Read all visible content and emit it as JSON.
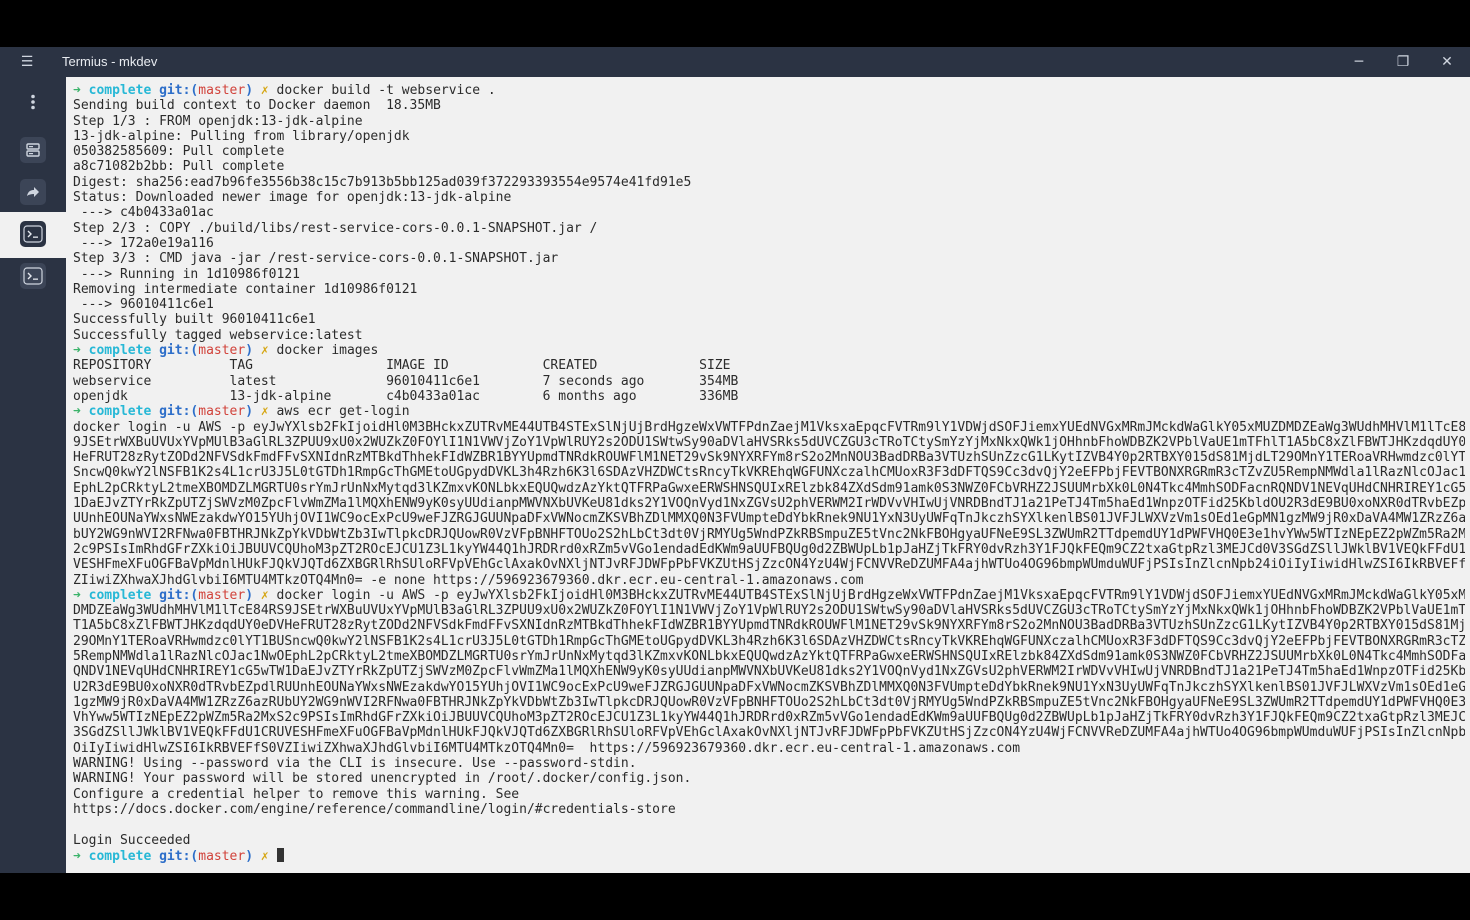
{
  "window": {
    "title": "Termius - mkdev"
  },
  "titlebar": {
    "menu_icon": "hamburger-icon",
    "minimize": "─",
    "maximize": "❐",
    "close": "✕"
  },
  "sidebar": {
    "items": [
      {
        "name": "more-options",
        "icon": "vertical-dots-icon"
      },
      {
        "name": "hosts",
        "icon": "server-icon"
      },
      {
        "name": "port-forwarding",
        "icon": "forward-icon"
      },
      {
        "name": "terminal-1",
        "icon": "terminal-icon",
        "active": true
      },
      {
        "name": "terminal-2",
        "icon": "terminal-icon"
      }
    ]
  },
  "prompt": {
    "arrow": "➜",
    "dir": "complete",
    "git": "git:",
    "paren_open": "(",
    "branch": "master",
    "paren_close": ")",
    "x": "✗"
  },
  "lines": [
    {
      "p": 1,
      "t": "docker build -t webservice ."
    },
    {
      "t": "Sending build context to Docker daemon  18.35MB"
    },
    {
      "t": "Step 1/3 : FROM openjdk:13-jdk-alpine"
    },
    {
      "t": "13-jdk-alpine: Pulling from library/openjdk"
    },
    {
      "t": "050382585609: Pull complete"
    },
    {
      "t": "a8c71082b2bb: Pull complete"
    },
    {
      "t": "Digest: sha256:ead7b96fe3556b38c15c7b913b5bb125ad039f372293393554e9574e41fd91e5"
    },
    {
      "t": "Status: Downloaded newer image for openjdk:13-jdk-alpine"
    },
    {
      "t": " ---> c4b0433a01ac"
    },
    {
      "t": "Step 2/3 : COPY ./build/libs/rest-service-cors-0.0.1-SNAPSHOT.jar /"
    },
    {
      "t": " ---> 172a0e19a116"
    },
    {
      "t": "Step 3/3 : CMD java -jar /rest-service-cors-0.0.1-SNAPSHOT.jar"
    },
    {
      "t": " ---> Running in 1d10986f0121"
    },
    {
      "t": "Removing intermediate container 1d10986f0121"
    },
    {
      "t": " ---> 96010411c6e1"
    },
    {
      "t": "Successfully built 96010411c6e1"
    },
    {
      "t": "Successfully tagged webservice:latest"
    },
    {
      "p": 1,
      "t": "docker images"
    },
    {
      "t": "REPOSITORY          TAG                 IMAGE ID            CREATED             SIZE"
    },
    {
      "t": "webservice          latest              96010411c6e1        7 seconds ago       354MB"
    },
    {
      "t": "openjdk             13-jdk-alpine       c4b0433a01ac        6 months ago        336MB"
    },
    {
      "p": 1,
      "t": "aws ecr get-login"
    },
    {
      "t": "docker login -u AWS -p eyJwYXlsb2FkIjoidHl0M3BHckxZUTRvME44UTB4STExSlNjUjBrdHgzeWxVWTFPdnZaejM1VksxaEpqcFVTRm9lY1VDWjdSOFJiemxYUEdNVGxMRmJMckdWaGlkY05xMUZDMDZEaWg3WUdhMHVlM1lTcE84RS"
    },
    {
      "t": "9JSEtrWXBuUVUxYVpMUlB3aGlRL3ZPUU9xU0x2WUZkZ0FOYlI1N1VWVjZoY1VpWlRUY2s2ODU1SWtwSy90aDVlaHVSRks5dUVCZGU3cTRoTCtySmYzYjMxNkxQWk1jOHhnbFhoWDBZK2VPblVaUE1mTFhlT1A5bC8xZlFBWTJHKzdqdUY0eDV"
    },
    {
      "t": "HeFRUT28zRytZODd2NFVSdkFmdFFvSXNIdnRzMTBkdThhekFIdWZBR1BYYUpmdTNRdkROUWFlM1NET29vSk9NYXRFYm8rS2o2MnNOU3BadDRBa3VTUzhSUnZzcG1LKytIZVB4Y0p2RTBXY015dS81MjdLT29OMnY1TERoaVRHwmdzc0lYT1BU"
    },
    {
      "t": "SncwQ0kwY2lNSFB1K2s4L1crU3J5L0tGTDh1RmpGcThGMEtoUGpydDVKL3h4Rzh6K3l6SDAzVHZDWCtsRncyTkVKREhqWGFUNXczalhCMUoxR3F3dDFTQS9Cc3dvQjY2eEFPbjFEVTBONXRGRmR3cTZvZU5RempNMWdla1lRazNlcOJac1NwO"
    },
    {
      "t": "EphL2pCRktyL2tmeXBOMDZLMGRTU0srYmJrUnNxMytqd3lKZmxvKONLbkxEQUQwdzAzYktQTFRPaGwxeERWSHNSQUIxRElzbk84ZXdSdm91amk0S3NWZ0FCbVRHZ2JSUUMrbXk0L0N4Tkc4MmhSODFacnRQNDV1NEVqUHdCNHRIREY1cG5wTW"
    },
    {
      "t": "1DaEJvZTYrRkZpUTZjSWVzM0ZpcFlvWmZMa1lMQXhENW9yK0syUUdianpMWVNXbUVKeU81dks2Y1VOQnVyd1NxZGVsU2phVERWM2IrWDVvVHIwUjVNRDBndTJ1a21PeTJ4Tm5haEd1WnpzOTFid25KbldOU2R3dE9BU0xoNXR0dTRvbEZpdlR"
    },
    {
      "t": "UUnhEOUNaYWxsNWEzakdwYO15YUhjOVI1WC9ocExPcU9weFJZRGJGUUNpaDFxVWNocmZKSVBhZDlMMXQ0N3FVUmpteDdYbkRnek9NU1YxN3UyUWFqTnJkczhSYXlkenlBS01JVFJLWXVzVm1sOEd1eGpMN1gzMW9jR0xDaVA4MW1ZRzZ6azRUR"
    },
    {
      "t": "bUY2WG9nWVI2RFNwa0FBTHRJNkZpYkVDbWtZb3IwTlpkcDRJQUowR0VzVFpBNHFTOUo2S2hLbCt3dt0VjRMYUg5WndPZkRBSmpuZE5tVnc2NkFBOHgyaUFNeE9SL3ZWUmR2TTdpemdUY1dPWFVHQ0E3e1hvYWw5WTIzNEpEZ2pWZm5Ra2MxS"
    },
    {
      "t": "2c9PSIsImRhdGFrZXkiOiJBUUVCQUhoM3pZT2ROcEJCU1Z3L1kyYW44Q1hJRDRrd0xRZm5vVGo1endadEdKWm9aUUFBQUg0d2ZBWUpLb1pJaHZjTkFRY0dvRzh3Y1FJQkFEQm9CZ2txaGtpRzl3MEJCd0V3SGdZSllJWklBV1VEQkFFdU1CRV"
    },
    {
      "t": "VESHFmeXFuOGFBaVpMdnlHUkFJQkVJQTd6ZXBGRlRhSUloRFVpVEhGclAxakOvNXljNTJvRFJDWFpPbFVKZUtHSjZzcON4YzU4WjFCNVVReDZUMFA4ajhWTUo4OG96bmpWUmduWUFjPSIsInZlcnNpb24iOiIyIiwidHlwZSI6IkRBVEFfS0V"
    },
    {
      "t": "ZIiwiZXhwaXJhdGlvbiI6MTU4MTkzOTQ4Mn0= -e none https://596923679360.dkr.ecr.eu-central-1.amazonaws.com"
    },
    {
      "p": 1,
      "t": "docker login -u AWS -p eyJwYXlsb2FkIjoidHl0M3BHckxZUTRvME44UTB4STExSlNjUjBrdHgzeWxVWTFPdnZaejM1VksxaEpqcFVTRm9lY1VDWjdSOFJiemxYUEdNVGxMRmJMckdWaGlkY05xMUZ"
    },
    {
      "t": "DMDZEaWg3WUdhMHVlM1lTcE84RS9JSEtrWXBuUVUxYVpMUlB3aGlRL3ZPUU9xU0x2WUZkZ0FOYlI1N1VWVjZoY1VpWlRUY2s2ODU1SWtwSy90aDVlaHVSRks5dUVCZGU3cTRoTCtySmYzYjMxNkxQWk1jOHhnbFhoWDBZK2VPblVaUE1mTFhl"
    },
    {
      "t": "T1A5bC8xZlFBWTJHKzdqdUY0eDVHeFRUT28zRytZODd2NFVSdkFmdFFvSXNIdnRzMTBkdThhekFIdWZBR1BYYUpmdTNRdkROUWFlM1NET29vSk9NYXRFYm8rS2o2MnNOU3BadDRBa3VTUzhSUnZzcG1LKytIZVB4Y0p2RTBXY015dS81MjdLT"
    },
    {
      "t": "29OMnY1TERoaVRHwmdzc0lYT1BUSncwQ0kwY2lNSFB1K2s4L1crU3J5L0tGTDh1RmpGcThGMEtoUGpydDVKL3h4Rzh6K3l6SDAzVHZDWCtsRncyTkVKREhqWGFUNXczalhCMUoxR3F3dDFTQS9Cc3dvQjY2eEFPbjFEVTBONXRGRmR3cTZvZU5"
    },
    {
      "t": "5RempNMWdla1lRazNlcOJac1NwOEphL2pCRktyL2tmeXBOMDZLMGRTU0srYmJrUnNxMytqd3lKZmxvKONLbkxEQUQwdzAzYktQTFRPaGwxeERWSHNSQUIxRElzbk84ZXdSdm91amk0S3NWZ0FCbVRHZ2JSUUMrbXk0L0N4Tkc4MmhSODFacnR"
    },
    {
      "t": "QNDV1NEVqUHdCNHRIREY1cG5wTW1DaEJvZTYrRkZpUTZjSWVzM0ZpcFlvWmZMa1lMQXhENW9yK0syUUdianpMWVNXbUVKeU81dks2Y1VOQnVyd1NxZGVsU2phVERWM2IrWDVvVHIwUjVNRDBndTJ1a21PeTJ4Tm5haEd1WnpzOTFid25KbldOU"
    },
    {
      "t": "U2R3dE9BU0xoNXR0dTRvbEZpdlRUUnhEOUNaYWxsNWEzakdwYO15YUhjOVI1WC9ocExPcU9weFJZRGJGUUNpaDFxVWNocmZKSVBhZDlMMXQ0N3FVUmpteDdYbkRnek9NU1YxN3UyUWFqTnJkczhSYXlkenlBS01JVFJLWXVzVm1sOEd1eGpMN"
    },
    {
      "t": "1gzMW9jR0xDaVA4MW1ZRzZ6azRUbUY2WG9nWVI2RFNwa0FBTHRJNkZpYkVDbWtZb3IwTlpkcDRJQUowR0VzVFpBNHFTOUo2S2hLbCt3dt0VjRMYUg5WndPZkRBSmpuZE5tVnc2NkFBOHgyaUFNeE9SL3ZWUmR2TTdpemdUY1dPWFVHQ0E3e1"
    },
    {
      "t": "VhYww5WTIzNEpEZ2pWZm5Ra2MxS2c9PSIsImRhdGFrZXkiOiJBUUVCQUhoM3pZT2ROcEJCU1Z3L1kyYW44Q1hJRDRrd0xRZm5vVGo1endadEdKWm9aUUFBQUg0d2ZBWUpLb1pJaHZjTkFRY0dvRzh3Y1FJQkFEQm9CZ2txaGtpRzl3MEJCd0V"
    },
    {
      "t": "3SGdZSllJWklBV1VEQkFFdU1CRUVESHFmeXFuOGFBaVpMdnlHUkFJQkVJQTd6ZXBGRlRhSUloRFVpVEhGclAxakOvNXljNTJvRFJDWFpPbFVKZUtHSjZzcON4YzU4WjFCNVVReDZUMFA4ajhWTUo4OG96bmpWUmduWUFjPSIsInZlcnNpb24i"
    },
    {
      "t": "OiIyIiwidHlwZSI6IkRBVEFfS0VZIiwiZXhwaXJhdGlvbiI6MTU4MTkzOTQ4Mn0=  https://596923679360.dkr.ecr.eu-central-1.amazonaws.com"
    },
    {
      "t": "WARNING! Using --password via the CLI is insecure. Use --password-stdin."
    },
    {
      "t": "WARNING! Your password will be stored unencrypted in /root/.docker/config.json."
    },
    {
      "t": "Configure a credential helper to remove this warning. See"
    },
    {
      "t": "https://docs.docker.com/engine/reference/commandline/login/#credentials-store"
    },
    {
      "t": ""
    },
    {
      "t": "Login Succeeded"
    },
    {
      "p": 1,
      "t": "",
      "cursor": true
    }
  ]
}
